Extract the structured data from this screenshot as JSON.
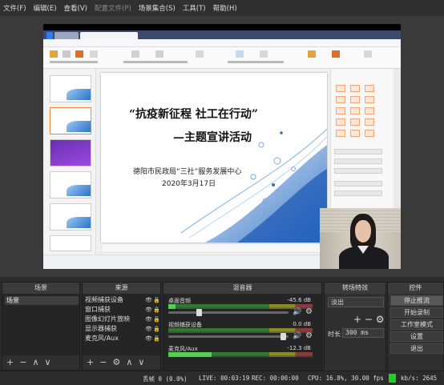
{
  "menu": {
    "file": "文件(F)",
    "edit": "编辑(E)",
    "view": "查看(V)",
    "profile": "配置文件(P)",
    "scene_collection": "场景集合(S)",
    "tools": "工具(T)",
    "help": "帮助(H)"
  },
  "slide": {
    "title_line1": "“抗疫新征程 社工在行动”",
    "title_line2": "—主题宣讲活动",
    "organization": "德阳市民政局“三社”服务发展中心",
    "date": "2020年3月17日"
  },
  "colors": {
    "obs_bg": "#2b2b2b",
    "dock_title_bg": "#3b3b3b",
    "accent_orange": "#e06c2a",
    "status_led": "#1fd11f"
  },
  "docks": {
    "scenes": {
      "title": "场景",
      "items": [
        "场景"
      ],
      "footer_icons": [
        "plus-icon",
        "minus-icon",
        "chevron-up-icon",
        "chevron-down-icon"
      ]
    },
    "sources": {
      "title": "来源",
      "items": [
        "视频捕获设备",
        "窗口捕获",
        "图像幻灯片放映",
        "显示器捕获",
        "麦克风/Aux"
      ],
      "footer_icons": [
        "plus-icon",
        "minus-icon",
        "gear-icon",
        "chevron-up-icon",
        "chevron-down-icon"
      ]
    },
    "mixer": {
      "title": "混音器",
      "channels": [
        {
          "name": "桌面音频",
          "db": "-45.6 dB",
          "level": 0.05,
          "volume": 0.25
        },
        {
          "name": "视频捕获设备",
          "db": "0.0 dB",
          "level": 0.0,
          "volume": 0.95
        },
        {
          "name": "麦克风/Aux",
          "db": "-12.3 dB",
          "level": 0.3,
          "volume": 0.95
        }
      ]
    },
    "transitions": {
      "title": "转场特效",
      "selected": "淡出",
      "duration_label": "时长",
      "duration_value": "300 ms"
    },
    "controls": {
      "title": "控件",
      "buttons": [
        "停止推流",
        "开始录制",
        "工作室模式",
        "设置",
        "退出"
      ]
    }
  },
  "status": {
    "dropped_frames": "丢帧 0 (0.0%)",
    "live": "LIVE: 00:03:19",
    "rec": "REC: 00:00:00",
    "cpu": "CPU: 16.8%, 30.00 fps",
    "bitrate": "kb/s: 2645"
  }
}
